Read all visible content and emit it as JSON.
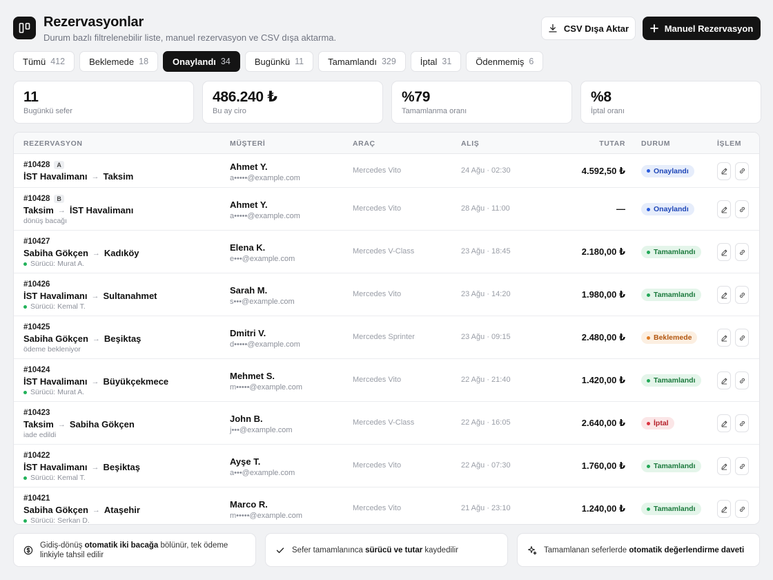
{
  "header": {
    "title": "Rezervasyonlar",
    "subtitle": "Durum bazlı filtrelenebilir liste, manuel rezervasyon ve CSV dışa aktarma.",
    "csv_label": "CSV Dışa Aktar",
    "new_label": "Manuel Rezervasyon"
  },
  "tabs": [
    {
      "label": "Tümü",
      "count": "412"
    },
    {
      "label": "Beklemede",
      "count": "18"
    },
    {
      "label": "Onaylandı",
      "count": "34",
      "active": true
    },
    {
      "label": "Bugünkü",
      "count": "11"
    },
    {
      "label": "Tamamlandı",
      "count": "329"
    },
    {
      "label": "İptal",
      "count": "31"
    },
    {
      "label": "Ödenmemiş",
      "count": "6"
    }
  ],
  "stats": [
    {
      "value": "11",
      "label": "Bugünkü sefer"
    },
    {
      "value": "486.240 ₺",
      "label": "Bu ay ciro"
    },
    {
      "value": "%79",
      "label": "Tamamlanma oranı"
    },
    {
      "value": "%8",
      "label": "İptal oranı"
    }
  ],
  "table": {
    "columns": [
      "REZERVASYON",
      "MÜŞTERİ",
      "ARAÇ",
      "ALIŞ",
      "TUTAR",
      "DURUM",
      "İŞLEM"
    ],
    "rows": [
      {
        "ref": "#10428",
        "leg": "A",
        "from": "İST Havalimanı",
        "to": "Taksim",
        "note": "",
        "driver": false,
        "name": "Ahmet Y.",
        "email": "a•••••@example.com",
        "vehicle": "Mercedes Vito",
        "pickup": "24 Ağu · 02:30",
        "amount": "4.592,50 ₺",
        "status": "Onaylandı",
        "kind": "confirmed"
      },
      {
        "ref": "#10428",
        "leg": "B",
        "from": "Taksim",
        "to": "İST Havalimanı",
        "note": "dönüş bacağı",
        "driver": false,
        "name": "Ahmet Y.",
        "email": "a•••••@example.com",
        "vehicle": "Mercedes Vito",
        "pickup": "28 Ağu · 11:00",
        "amount": "—",
        "status": "Onaylandı",
        "kind": "confirmed"
      },
      {
        "ref": "#10427",
        "leg": "",
        "from": "Sabiha Gökçen",
        "to": "Kadıköy",
        "note": "Sürücü: Murat A.",
        "driver": true,
        "name": "Elena K.",
        "email": "e•••@example.com",
        "vehicle": "Mercedes V-Class",
        "pickup": "23 Ağu · 18:45",
        "amount": "2.180,00 ₺",
        "status": "Tamamlandı",
        "kind": "done"
      },
      {
        "ref": "#10426",
        "leg": "",
        "from": "İST Havalimanı",
        "to": "Sultanahmet",
        "note": "Sürücü: Kemal T.",
        "driver": true,
        "name": "Sarah M.",
        "email": "s•••@example.com",
        "vehicle": "Mercedes Vito",
        "pickup": "23 Ağu · 14:20",
        "amount": "1.980,00 ₺",
        "status": "Tamamlandı",
        "kind": "done"
      },
      {
        "ref": "#10425",
        "leg": "",
        "from": "Sabiha Gökçen",
        "to": "Beşiktaş",
        "note": "ödeme bekleniyor",
        "driver": false,
        "name": "Dmitri V.",
        "email": "d•••••@example.com",
        "vehicle": "Mercedes Sprinter",
        "pickup": "23 Ağu · 09:15",
        "amount": "2.480,00 ₺",
        "status": "Beklemede",
        "kind": "pending"
      },
      {
        "ref": "#10424",
        "leg": "",
        "from": "İST Havalimanı",
        "to": "Büyükçekmece",
        "note": "Sürücü: Murat A.",
        "driver": true,
        "name": "Mehmet S.",
        "email": "m•••••@example.com",
        "vehicle": "Mercedes Vito",
        "pickup": "22 Ağu · 21:40",
        "amount": "1.420,00 ₺",
        "status": "Tamamlandı",
        "kind": "done"
      },
      {
        "ref": "#10423",
        "leg": "",
        "from": "Taksim",
        "to": "Sabiha Gökçen",
        "note": "iade edildi",
        "driver": false,
        "name": "John B.",
        "email": "j•••@example.com",
        "vehicle": "Mercedes V-Class",
        "pickup": "22 Ağu · 16:05",
        "amount": "2.640,00 ₺",
        "status": "İptal",
        "kind": "cancel"
      },
      {
        "ref": "#10422",
        "leg": "",
        "from": "İST Havalimanı",
        "to": "Beşiktaş",
        "note": "Sürücü: Kemal T.",
        "driver": true,
        "name": "Ayşe T.",
        "email": "a•••@example.com",
        "vehicle": "Mercedes Vito",
        "pickup": "22 Ağu · 07:30",
        "amount": "1.760,00 ₺",
        "status": "Tamamlandı",
        "kind": "done"
      },
      {
        "ref": "#10421",
        "leg": "",
        "from": "Sabiha Gökçen",
        "to": "Ataşehir",
        "note": "Sürücü: Serkan D.",
        "driver": true,
        "name": "Marco R.",
        "email": "m•••••@example.com",
        "vehicle": "Mercedes Vito",
        "pickup": "21 Ağu · 23:10",
        "amount": "1.240,00 ₺",
        "status": "Tamamlandı",
        "kind": "done"
      }
    ]
  },
  "status_colors": {
    "confirmed": {
      "bg": "#e6edfb",
      "fg": "#1f47b8",
      "dot": "#2a5bdc"
    },
    "done": {
      "bg": "#e4f5ea",
      "fg": "#1b7a3d",
      "dot": "#22a857"
    },
    "pending": {
      "bg": "#fcefe1",
      "fg": "#b2560f",
      "dot": "#e07b22"
    },
    "cancel": {
      "bg": "#fbe6e7",
      "fg": "#b51f2a",
      "dot": "#db3441"
    }
  },
  "footer": [
    {
      "icon": "dollar-icon",
      "parts": [
        [
          "Gidiş-dönüş ",
          false
        ],
        [
          "otomatik iki bacağa",
          true
        ],
        [
          " bölünür, tek ödeme linkiyle tahsil edilir",
          false
        ]
      ]
    },
    {
      "icon": "check-icon",
      "parts": [
        [
          "Sefer tamamlanınca ",
          false
        ],
        [
          "sürücü ve tutar",
          true
        ],
        [
          " kaydedilir",
          false
        ]
      ]
    },
    {
      "icon": "sparkle-icon",
      "parts": [
        [
          "Tamamlanan seferlerde ",
          false
        ],
        [
          "otomatik değerlendirme daveti",
          true
        ]
      ]
    }
  ]
}
